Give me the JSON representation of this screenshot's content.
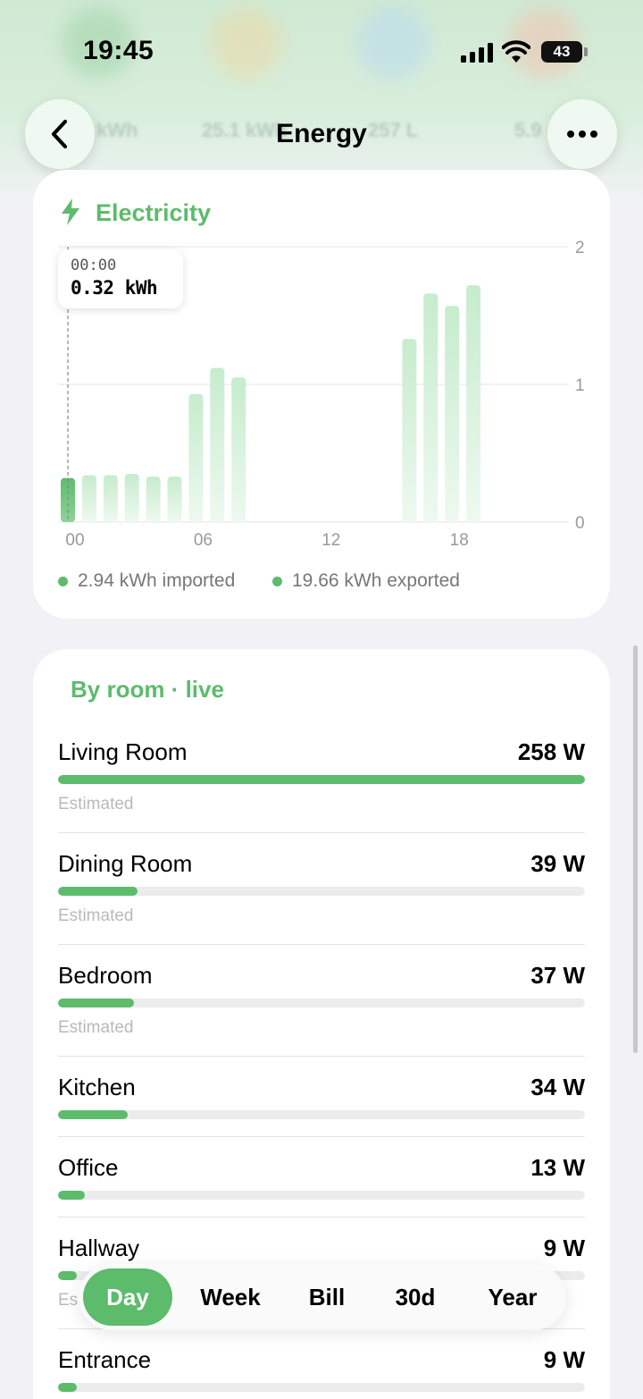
{
  "status_bar": {
    "time": "19:45",
    "battery": "43"
  },
  "nav": {
    "title": "Energy",
    "back_icon": "chevron-left-icon",
    "more_icon": "ellipsis-icon"
  },
  "background_summary": [
    "kWh",
    "25.1 kWh",
    "257 L",
    "5.9"
  ],
  "colors": {
    "accent": "#5dbb6c",
    "bar": "#cdeed3",
    "track": "#ececec"
  },
  "electricity": {
    "title": "Electricity",
    "icon": "bolt-icon",
    "tooltip": {
      "time": "00:00",
      "value": "0.32 kWh"
    },
    "imported": "2.94 kWh imported",
    "exported": "19.66 kWh exported"
  },
  "chart_data": {
    "type": "bar",
    "x_ticks": [
      "00",
      "06",
      "12",
      "18"
    ],
    "y_ticks": [
      "0",
      "1",
      "2"
    ],
    "ylim": [
      0,
      2
    ],
    "x_label": "",
    "y_label": "",
    "highlighted_hour": 0,
    "hours": [
      0,
      1,
      2,
      3,
      4,
      5,
      6,
      7,
      8,
      9,
      10,
      11,
      12,
      13,
      14,
      15,
      16,
      17,
      18,
      19,
      20,
      21,
      22,
      23
    ],
    "values": [
      0.32,
      0.34,
      0.34,
      0.35,
      0.33,
      0.33,
      0.93,
      1.12,
      1.05,
      0,
      0,
      0,
      0,
      0,
      0,
      0,
      1.33,
      1.66,
      1.57,
      1.72,
      0,
      0,
      0,
      0
    ]
  },
  "rooms": {
    "title": "By room · live",
    "max_watts": 258,
    "items": [
      {
        "name": "Living Room",
        "watts": "258 W",
        "value": 258,
        "note": "Estimated"
      },
      {
        "name": "Dining Room",
        "watts": "39 W",
        "value": 39,
        "note": "Estimated"
      },
      {
        "name": "Bedroom",
        "watts": "37 W",
        "value": 37,
        "note": "Estimated"
      },
      {
        "name": "Kitchen",
        "watts": "34 W",
        "value": 34,
        "note": ""
      },
      {
        "name": "Office",
        "watts": "13 W",
        "value": 13,
        "note": ""
      },
      {
        "name": "Hallway",
        "watts": "9 W",
        "value": 9,
        "note": "Es"
      },
      {
        "name": "Entrance",
        "watts": "9 W",
        "value": 9,
        "note": ""
      }
    ]
  },
  "range_tabs": {
    "active": "Day",
    "items": [
      "Day",
      "Week",
      "Bill",
      "30d",
      "Year"
    ]
  }
}
